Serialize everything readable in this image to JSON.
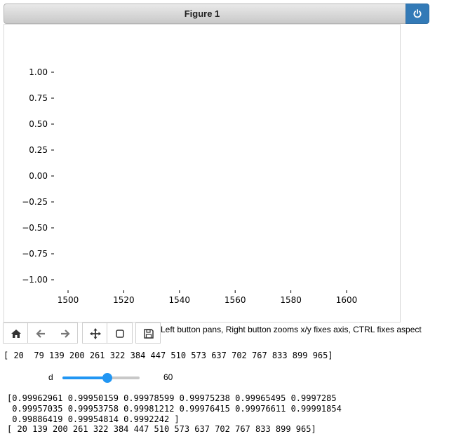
{
  "figure": {
    "title": "Figure 1"
  },
  "icons": {
    "power": "power-icon",
    "home": "home-icon",
    "back": "arrow-left-icon",
    "forward": "arrow-right-icon",
    "pan": "move-icon",
    "zoom": "square-icon",
    "save": "floppy-disk-icon"
  },
  "colors": {
    "power_button": "#337ab7",
    "slider": "#2196f3"
  },
  "chart_data": {
    "type": "line",
    "title": "",
    "xlabel": "",
    "ylabel": "",
    "xlim": [
      1495,
      1609
    ],
    "ylim": [
      -1.1,
      1.1
    ],
    "x_ticks": [
      "1500",
      "1520",
      "1540",
      "1560",
      "1580",
      "1600"
    ],
    "y_ticks": [
      "1.00",
      "0.75",
      "0.50",
      "0.25",
      "0.00",
      "−0.25",
      "−0.50",
      "−0.75",
      "−1.00"
    ],
    "series": [],
    "grid": false
  },
  "toolbar": {
    "help_text": "Left button pans, Right button zooms x/y fixes axis, CTRL fixes aspect"
  },
  "output": {
    "line1": "[ 20  79 139 200 261 322 384 447 510 573 637 702 767 833 899 965]",
    "array_lines": [
      "[0.99962961 0.99950159 0.99978599 0.99975238 0.99965495 0.9997285",
      " 0.99957035 0.99953758 0.99981212 0.99976415 0.99976611 0.99991854",
      " 0.99886419 0.99954814 0.9992242 ]"
    ],
    "line_last": "[ 20 139 200 261 322 384 447 510 573 637 702 767 833 899 965]"
  },
  "slider": {
    "label": "d",
    "value": "60",
    "fraction": 0.58
  }
}
